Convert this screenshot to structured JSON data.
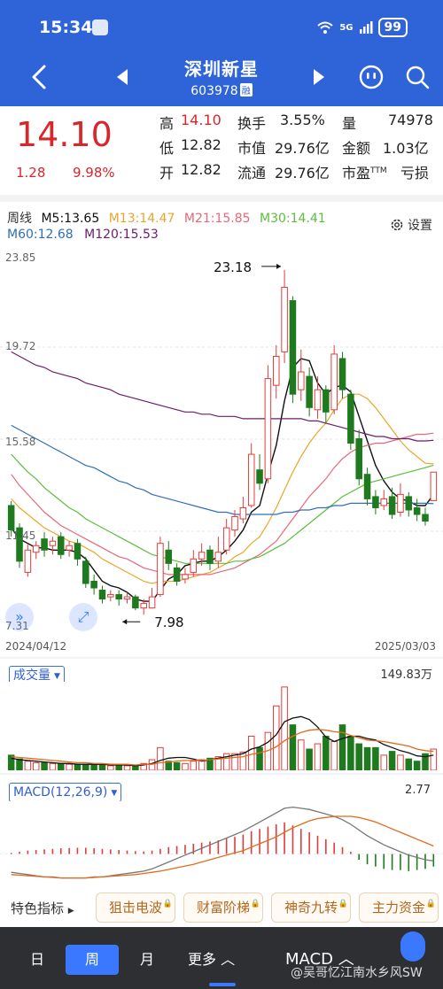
{
  "status": {
    "time": "15:34",
    "network": "5G",
    "battery": "99"
  },
  "header": {
    "name": "深圳新星",
    "code": "603978",
    "badge": "融"
  },
  "quote": {
    "price": "14.10",
    "change": "1.28",
    "change_pct": "9.98%",
    "high_label": "高",
    "high": "14.10",
    "low_label": "低",
    "low": "12.82",
    "open_label": "开",
    "open": "12.82",
    "turnover_label": "换手",
    "turnover": "3.55%",
    "mktcap_label": "市值",
    "mktcap": "29.76亿",
    "float_label": "流通",
    "float_cap": "29.76亿",
    "volume_label": "量",
    "volume": "74978",
    "amount_label": "金额",
    "amount": "1.03亿",
    "pe_label": "市盈",
    "pe_tm": "TTM",
    "pe": "亏损"
  },
  "ma_legend": {
    "period": "周线",
    "m5": "M5:13.65",
    "m13": "M13:14.47",
    "m21": "M21:15.85",
    "m30": "M30:14.41",
    "m60": "M60:12.68",
    "m120": "M120:15.53",
    "settings": "设置"
  },
  "colors": {
    "brand": "#2f64d8",
    "up": "#e23b3b",
    "down": "#1f7a1f",
    "m5": "#111111",
    "m13": "#e8a72b",
    "m21": "#e8677a",
    "m30": "#5cbf3c",
    "m60": "#2e6fb8",
    "m120": "#6b1d6b"
  },
  "chart_data": [
    {
      "type": "candlestick",
      "title": "",
      "y_ticks": [
        "23.85",
        "19.72",
        "15.58",
        "11.45",
        "7.31"
      ],
      "ylim": [
        7.31,
        23.85
      ],
      "x_start": "2024/04/12",
      "x_end": "2025/03/03",
      "max_annotation": "23.18",
      "min_annotation": "7.98",
      "candles": [
        {
          "o": 12.6,
          "c": 11.5,
          "h": 12.8,
          "l": 11.2
        },
        {
          "o": 11.6,
          "c": 10.1,
          "h": 11.8,
          "l": 9.8
        },
        {
          "o": 9.6,
          "c": 10.6,
          "h": 10.9,
          "l": 9.4
        },
        {
          "o": 10.5,
          "c": 10.8,
          "h": 11.0,
          "l": 10.2
        },
        {
          "o": 11.1,
          "c": 10.6,
          "h": 11.4,
          "l": 10.3
        },
        {
          "o": 10.8,
          "c": 11.0,
          "h": 11.2,
          "l": 10.4
        },
        {
          "o": 11.2,
          "c": 10.4,
          "h": 11.4,
          "l": 10.2
        },
        {
          "o": 10.6,
          "c": 10.8,
          "h": 11.0,
          "l": 10.3
        },
        {
          "o": 10.9,
          "c": 10.2,
          "h": 11.1,
          "l": 9.9
        },
        {
          "o": 10.1,
          "c": 9.1,
          "h": 10.3,
          "l": 8.9
        },
        {
          "o": 9.2,
          "c": 8.9,
          "h": 9.5,
          "l": 8.6
        },
        {
          "o": 8.8,
          "c": 8.4,
          "h": 9.0,
          "l": 8.2
        },
        {
          "o": 8.5,
          "c": 8.6,
          "h": 8.8,
          "l": 8.3
        },
        {
          "o": 8.6,
          "c": 8.4,
          "h": 8.8,
          "l": 8.1
        },
        {
          "o": 8.4,
          "c": 8.5,
          "h": 8.7,
          "l": 8.2
        },
        {
          "o": 8.5,
          "c": 8.0,
          "h": 8.6,
          "l": 7.9
        },
        {
          "o": 8.0,
          "c": 8.2,
          "h": 8.4,
          "l": 7.7
        },
        {
          "o": 8.0,
          "c": 8.5,
          "h": 8.9,
          "l": 7.98
        },
        {
          "o": 8.6,
          "c": 10.9,
          "h": 11.2,
          "l": 8.5
        },
        {
          "o": 10.6,
          "c": 10.0,
          "h": 11.0,
          "l": 9.7
        },
        {
          "o": 9.8,
          "c": 9.2,
          "h": 10.0,
          "l": 9.0
        },
        {
          "o": 9.3,
          "c": 9.5,
          "h": 9.8,
          "l": 9.1
        },
        {
          "o": 9.6,
          "c": 10.2,
          "h": 10.6,
          "l": 9.4
        },
        {
          "o": 10.2,
          "c": 10.5,
          "h": 10.9,
          "l": 9.9
        },
        {
          "o": 10.6,
          "c": 10.0,
          "h": 10.8,
          "l": 9.7
        },
        {
          "o": 10.1,
          "c": 10.5,
          "h": 11.2,
          "l": 9.8
        },
        {
          "o": 10.6,
          "c": 11.6,
          "h": 12.0,
          "l": 10.4
        },
        {
          "o": 11.5,
          "c": 12.1,
          "h": 12.4,
          "l": 11.2
        },
        {
          "o": 12.0,
          "c": 12.5,
          "h": 13.0,
          "l": 11.8
        },
        {
          "o": 12.6,
          "c": 14.9,
          "h": 15.4,
          "l": 12.5
        },
        {
          "o": 14.2,
          "c": 13.6,
          "h": 14.9,
          "l": 13.3
        },
        {
          "o": 13.8,
          "c": 18.3,
          "h": 18.9,
          "l": 13.6
        },
        {
          "o": 18.0,
          "c": 19.3,
          "h": 19.8,
          "l": 17.4
        },
        {
          "o": 19.5,
          "c": 22.4,
          "h": 23.18,
          "l": 19.0
        },
        {
          "o": 21.8,
          "c": 17.6,
          "h": 22.0,
          "l": 17.2
        },
        {
          "o": 17.8,
          "c": 18.6,
          "h": 19.6,
          "l": 17.3
        },
        {
          "o": 18.4,
          "c": 17.0,
          "h": 18.8,
          "l": 16.6
        },
        {
          "o": 16.9,
          "c": 17.8,
          "h": 18.4,
          "l": 16.5
        },
        {
          "o": 17.8,
          "c": 16.8,
          "h": 18.0,
          "l": 16.3
        },
        {
          "o": 16.9,
          "c": 19.4,
          "h": 19.8,
          "l": 16.7
        },
        {
          "o": 19.2,
          "c": 17.8,
          "h": 19.5,
          "l": 17.4
        },
        {
          "o": 17.6,
          "c": 15.4,
          "h": 17.8,
          "l": 15.1
        },
        {
          "o": 15.6,
          "c": 13.8,
          "h": 16.0,
          "l": 13.5
        },
        {
          "o": 14.0,
          "c": 12.9,
          "h": 14.3,
          "l": 12.6
        },
        {
          "o": 13.0,
          "c": 12.5,
          "h": 13.3,
          "l": 12.2
        },
        {
          "o": 12.6,
          "c": 12.9,
          "h": 13.3,
          "l": 12.4
        },
        {
          "o": 13.0,
          "c": 12.2,
          "h": 13.4,
          "l": 12.0
        },
        {
          "o": 12.3,
          "c": 13.1,
          "h": 13.6,
          "l": 12.1
        },
        {
          "o": 13.0,
          "c": 12.4,
          "h": 13.2,
          "l": 12.1
        },
        {
          "o": 12.5,
          "c": 12.2,
          "h": 12.9,
          "l": 11.9
        },
        {
          "o": 12.2,
          "c": 11.9,
          "h": 12.5,
          "l": 11.7
        },
        {
          "o": 12.82,
          "c": 14.1,
          "h": 14.1,
          "l": 12.82
        }
      ],
      "series": [
        {
          "name": "M5",
          "color": "#111111",
          "values": [
            11.6,
            11.1,
            10.9,
            10.7,
            10.7,
            10.6,
            10.6,
            10.6,
            10.5,
            10.2,
            9.7,
            9.2,
            9.0,
            8.9,
            8.7,
            8.4,
            8.3,
            8.3,
            8.8,
            9.3,
            9.5,
            9.9,
            10.0,
            10.1,
            10.1,
            10.3,
            10.6,
            11.0,
            11.5,
            12.3,
            12.6,
            14.0,
            15.3,
            17.3,
            18.8,
            19.2,
            19.1,
            18.1,
            17.6,
            17.9,
            18.0,
            17.7,
            16.6,
            15.5,
            14.4,
            13.7,
            13.2,
            12.9,
            12.8,
            12.6,
            12.6,
            13.1
          ]
        },
        {
          "name": "M13",
          "color": "#e8a72b",
          "values": [
            12.9,
            12.5,
            12.2,
            11.9,
            11.6,
            11.4,
            11.2,
            11.0,
            10.9,
            10.7,
            10.5,
            10.2,
            10.0,
            9.8,
            9.6,
            9.4,
            9.2,
            9.1,
            9.2,
            9.2,
            9.2,
            9.3,
            9.4,
            9.5,
            9.6,
            9.8,
            10.0,
            10.3,
            10.5,
            10.9,
            11.2,
            11.8,
            12.5,
            13.3,
            14.1,
            14.8,
            15.4,
            15.9,
            16.3,
            16.9,
            17.4,
            17.6,
            17.6,
            17.4,
            17.0,
            16.5,
            16.0,
            15.5,
            15.1,
            14.8,
            14.5,
            14.47
          ]
        },
        {
          "name": "M21",
          "color": "#e8677a",
          "values": [
            14.0,
            13.5,
            13.1,
            12.7,
            12.3,
            12.0,
            11.7,
            11.5,
            11.3,
            11.1,
            10.9,
            10.7,
            10.5,
            10.3,
            10.2,
            10.0,
            9.8,
            9.7,
            9.6,
            9.5,
            9.5,
            9.5,
            9.5,
            9.5,
            9.5,
            9.6,
            9.7,
            9.8,
            10.0,
            10.2,
            10.4,
            10.7,
            11.0,
            11.5,
            12.0,
            12.5,
            13.0,
            13.4,
            13.8,
            14.3,
            14.7,
            15.0,
            15.2,
            15.3,
            15.4,
            15.4,
            15.5,
            15.6,
            15.7,
            15.8,
            15.8,
            15.85
          ]
        },
        {
          "name": "M30",
          "color": "#5cbf3c",
          "values": [
            14.9,
            14.5,
            14.1,
            13.8,
            13.4,
            13.1,
            12.8,
            12.5,
            12.3,
            12.0,
            11.8,
            11.6,
            11.4,
            11.2,
            11.0,
            10.8,
            10.6,
            10.4,
            10.3,
            10.2,
            10.1,
            10.0,
            10.0,
            10.0,
            10.0,
            10.0,
            10.0,
            10.1,
            10.1,
            10.2,
            10.3,
            10.5,
            10.7,
            10.9,
            11.2,
            11.5,
            11.8,
            12.1,
            12.4,
            12.7,
            13.0,
            13.2,
            13.4,
            13.6,
            13.7,
            13.8,
            13.9,
            14.0,
            14.1,
            14.2,
            14.3,
            14.41
          ]
        },
        {
          "name": "M60",
          "color": "#2e6fb8",
          "values": [
            16.2,
            16.0,
            15.8,
            15.6,
            15.4,
            15.2,
            15.0,
            14.8,
            14.6,
            14.4,
            14.3,
            14.1,
            13.9,
            13.7,
            13.6,
            13.4,
            13.3,
            13.1,
            13.0,
            12.9,
            12.8,
            12.7,
            12.6,
            12.5,
            12.4,
            12.3,
            12.3,
            12.2,
            12.2,
            12.2,
            12.2,
            12.2,
            12.2,
            12.3,
            12.3,
            12.4,
            12.4,
            12.5,
            12.5,
            12.6,
            12.6,
            12.7,
            12.7,
            12.7,
            12.7,
            12.7,
            12.7,
            12.7,
            12.7,
            12.7,
            12.7,
            12.68
          ]
        },
        {
          "name": "M120",
          "color": "#6b1d6b",
          "values": [
            19.5,
            19.3,
            19.1,
            18.9,
            18.8,
            18.6,
            18.5,
            18.4,
            18.3,
            18.1,
            18.0,
            17.9,
            17.8,
            17.6,
            17.5,
            17.4,
            17.3,
            17.2,
            17.1,
            17.0,
            16.9,
            16.8,
            16.8,
            16.7,
            16.7,
            16.6,
            16.6,
            16.6,
            16.5,
            16.5,
            16.5,
            16.5,
            16.5,
            16.5,
            16.5,
            16.5,
            16.4,
            16.4,
            16.3,
            16.2,
            16.1,
            16.0,
            15.9,
            15.8,
            15.7,
            15.7,
            15.6,
            15.6,
            15.6,
            15.5,
            15.5,
            15.53
          ]
        }
      ]
    },
    {
      "type": "bar",
      "title": "成交量",
      "max_label": "149.83万",
      "values": [
        20,
        15,
        12,
        10,
        10,
        9,
        9,
        8,
        8,
        7,
        8,
        7,
        6,
        6,
        6,
        6,
        9,
        14,
        30,
        12,
        10,
        9,
        12,
        14,
        16,
        18,
        22,
        22,
        24,
        45,
        30,
        50,
        85,
        110,
        60,
        40,
        28,
        35,
        45,
        38,
        60,
        45,
        35,
        30,
        30,
        20,
        25,
        20,
        15,
        12,
        22,
        28
      ],
      "series": [
        {
          "name": "MA5",
          "color": "#111111",
          "values": [
            16,
            14,
            13,
            12,
            11,
            10,
            9,
            9,
            8,
            8,
            8,
            8,
            7,
            7,
            7,
            6,
            7,
            9,
            13,
            16,
            17,
            17,
            15,
            12,
            14,
            16,
            18,
            20,
            22,
            28,
            31,
            37,
            47,
            64,
            69,
            71,
            67,
            57,
            44,
            38,
            42,
            45,
            45,
            42,
            40,
            34,
            30,
            26,
            23,
            19,
            18,
            20
          ]
        },
        {
          "name": "MA10",
          "color": "#e36a1d",
          "values": [
            18,
            17,
            16,
            15,
            14,
            13,
            12,
            11,
            10,
            10,
            9,
            9,
            8,
            8,
            8,
            7,
            8,
            8,
            10,
            11,
            12,
            13,
            13,
            13,
            14,
            15,
            16,
            17,
            18,
            21,
            23,
            26,
            31,
            39,
            45,
            50,
            53,
            54,
            53,
            51,
            50,
            46,
            43,
            40,
            39,
            38,
            36,
            34,
            32,
            28,
            26,
            25
          ]
        }
      ]
    },
    {
      "type": "macd",
      "title": "MACD(12,26,9)",
      "max_label": "2.77",
      "hist": [
        0.1,
        0.2,
        0.3,
        0.35,
        0.4,
        0.45,
        0.5,
        0.52,
        0.55,
        0.55,
        0.5,
        0.45,
        0.4,
        0.35,
        0.3,
        0.25,
        0.22,
        0.3,
        0.45,
        0.6,
        0.7,
        0.8,
        0.9,
        1.0,
        1.1,
        1.2,
        1.35,
        1.5,
        1.7,
        2.0,
        2.2,
        2.4,
        2.6,
        2.77,
        2.5,
        2.2,
        1.9,
        1.6,
        1.3,
        1.0,
        0.6,
        0.2,
        -0.5,
        -0.9,
        -1.1,
        -1.3,
        -1.4,
        -1.4,
        -1.5,
        -1.4,
        -1.3,
        -1.1
      ],
      "series": [
        {
          "name": "DIF",
          "color": "#777777",
          "values": [
            -1.6,
            -1.7,
            -1.8,
            -1.9,
            -2.0,
            -2.0,
            -2.1,
            -2.1,
            -2.1,
            -2.1,
            -2.0,
            -2.0,
            -1.9,
            -1.8,
            -1.7,
            -1.6,
            -1.5,
            -1.3,
            -1.0,
            -0.7,
            -0.4,
            -0.1,
            0.2,
            0.5,
            0.8,
            1.1,
            1.4,
            1.7,
            2.0,
            2.4,
            2.8,
            3.2,
            3.6,
            4.0,
            4.1,
            4.0,
            3.9,
            3.7,
            3.5,
            3.3,
            3.0,
            2.6,
            2.1,
            1.6,
            1.2,
            0.8,
            0.5,
            0.2,
            -0.1,
            -0.3,
            -0.5,
            -0.6
          ]
        },
        {
          "name": "DEA",
          "color": "#e36a1d",
          "values": [
            -1.8,
            -1.85,
            -1.9,
            -1.95,
            -2.0,
            -2.05,
            -2.1,
            -2.1,
            -2.1,
            -2.1,
            -2.05,
            -2.0,
            -1.95,
            -1.9,
            -1.85,
            -1.8,
            -1.7,
            -1.6,
            -1.5,
            -1.35,
            -1.2,
            -1.05,
            -0.9,
            -0.7,
            -0.5,
            -0.3,
            -0.1,
            0.1,
            0.3,
            0.6,
            0.9,
            1.2,
            1.5,
            1.9,
            2.3,
            2.6,
            2.9,
            3.1,
            3.2,
            3.3,
            3.3,
            3.3,
            3.2,
            3.0,
            2.8,
            2.5,
            2.2,
            1.9,
            1.6,
            1.3,
            1.0,
            0.7
          ]
        }
      ]
    }
  ],
  "volume_panel": {
    "label": "成交量"
  },
  "macd_panel": {
    "label": "MACD(12,26,9)"
  },
  "features": {
    "label": "特色指标",
    "items": [
      "狙击电波",
      "财富阶梯",
      "神奇九转",
      "主力资金"
    ]
  },
  "bottom_tabs": {
    "day": "日",
    "week": "周",
    "month": "月",
    "more": "更多",
    "macd": "MACD"
  },
  "watermark": "@吴哥忆江南水乡风SW"
}
